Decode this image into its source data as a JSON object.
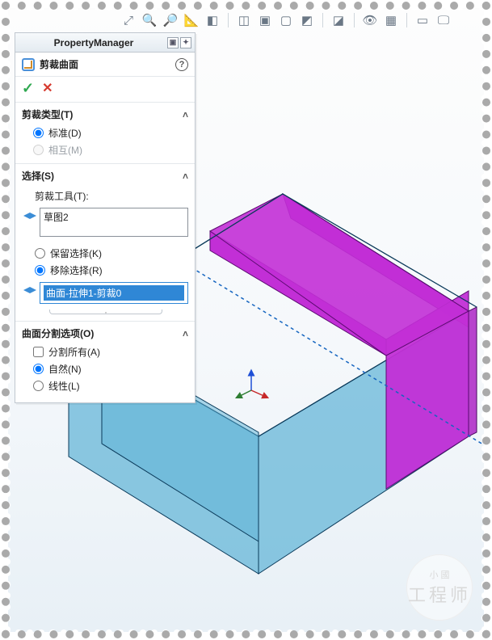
{
  "panel": {
    "header_title": "PropertyManager",
    "feature_name": "剪裁曲面",
    "sections": {
      "trim_type": {
        "title": "剪裁类型(T)",
        "standard": "标准(D)",
        "mutual": "相互(M)"
      },
      "selection": {
        "title": "选择(S)",
        "tool_label": "剪裁工具(T):",
        "tool_item": "草图2",
        "keep": "保留选择(K)",
        "remove": "移除选择(R)",
        "selected_item": "曲面-拉伸1-剪裁0"
      },
      "split_options": {
        "title": "曲面分割选项(O)",
        "split_all": "分割所有(A)",
        "natural": "自然(N)",
        "linear": "线性(L)"
      }
    }
  },
  "watermark": {
    "small": "小 國",
    "big": "工程师"
  }
}
